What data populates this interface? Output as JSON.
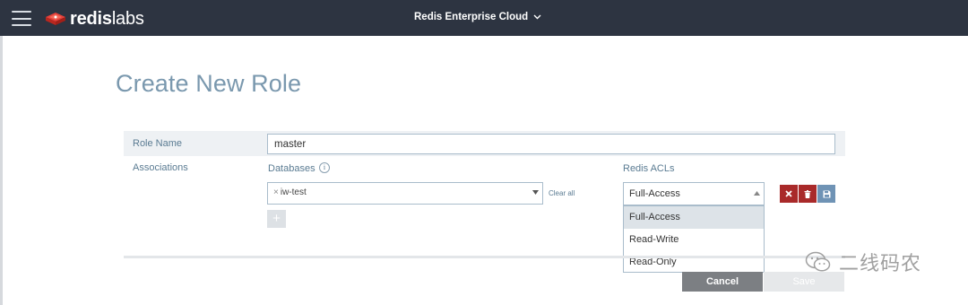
{
  "header": {
    "logo_bold": "redis",
    "logo_light": "labs",
    "env_label": "Redis Enterprise Cloud",
    "env_icon": "chevron-down-icon",
    "menu_icon": "hamburger-icon"
  },
  "page": {
    "title": "Create New Role"
  },
  "form": {
    "role_name_label": "Role Name",
    "role_name_value": "master",
    "associations_label": "Associations",
    "databases_label": "Databases",
    "databases_info": "i",
    "redis_acls_label": "Redis ACLs",
    "db_tag_remove": "×",
    "db_tag": "iw-test",
    "clear_all": "Clear all",
    "acl_selected": "Full-Access",
    "acl_options": [
      "Full-Access",
      "Read-Write",
      "Read-Only"
    ],
    "add_label": "+"
  },
  "actions": {
    "cancel": "Cancel",
    "save": "Save"
  },
  "watermark": {
    "text": "二线码农"
  },
  "colors": {
    "header_bg": "#2d3441",
    "title": "#7a98ae",
    "danger": "#a92a2a",
    "save_icon_bg": "#6f93b5",
    "cancel_bg": "#7c7f83"
  }
}
